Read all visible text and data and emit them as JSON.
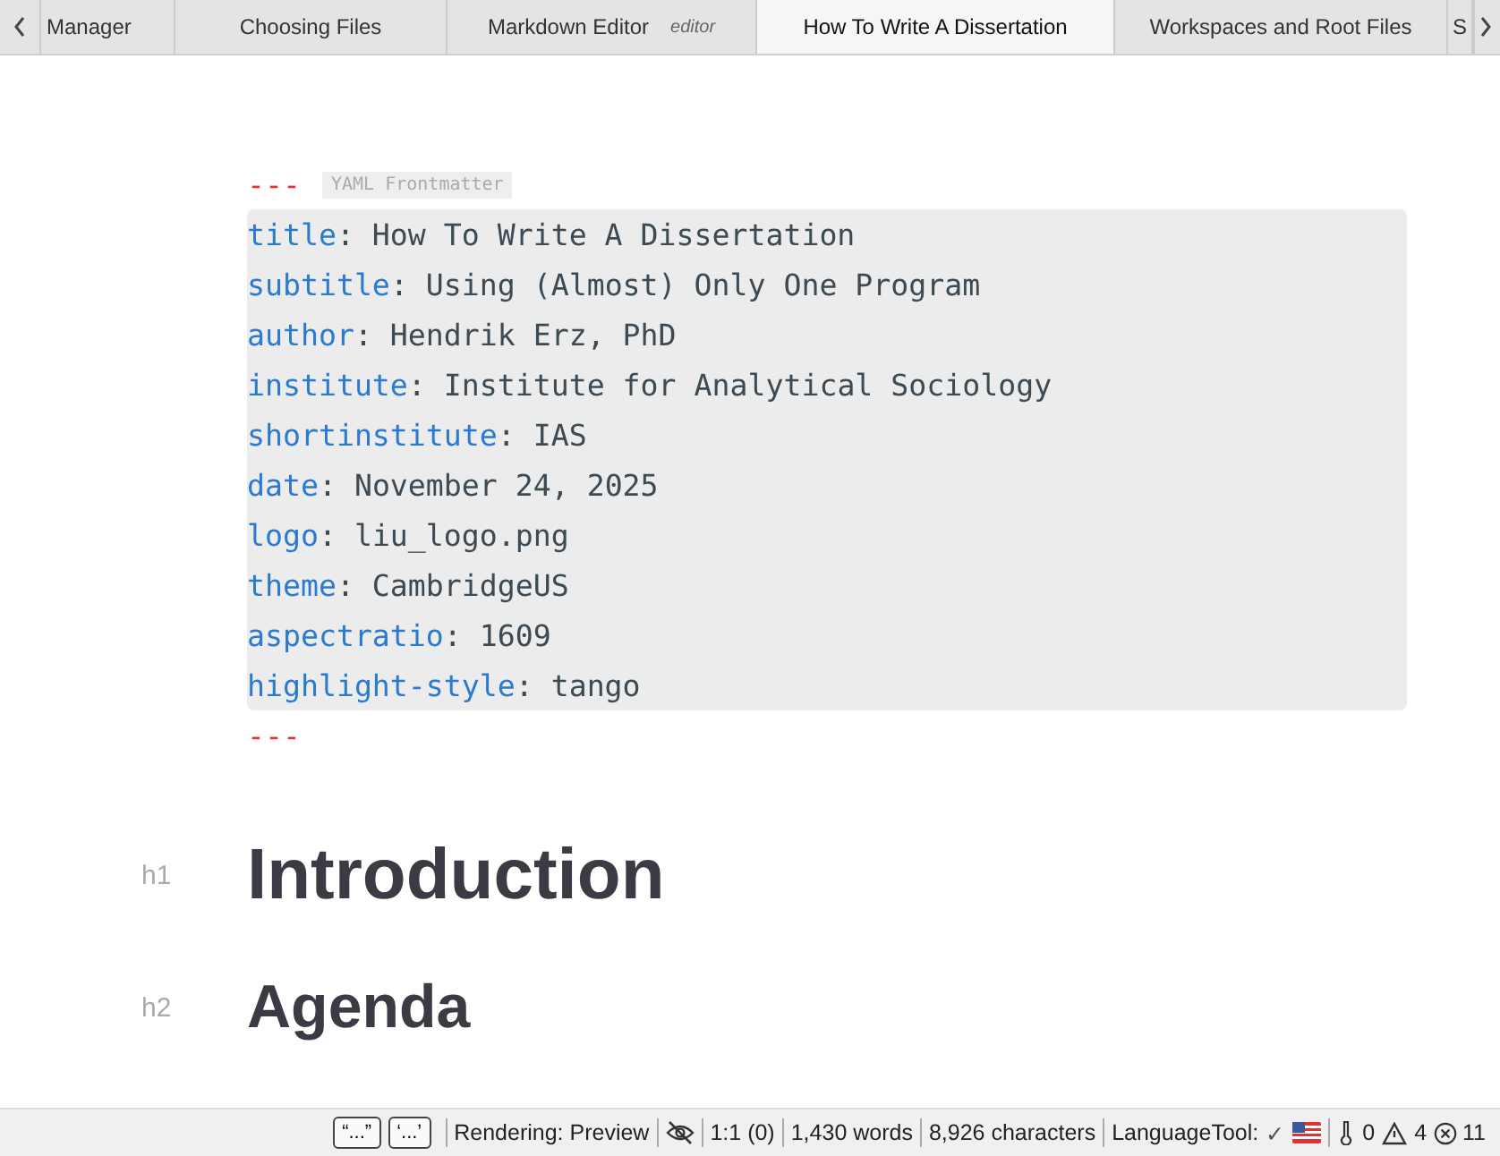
{
  "tabs": [
    {
      "label": "Manager",
      "selected": false
    },
    {
      "label": "Choosing Files",
      "selected": false
    },
    {
      "label": "Markdown Editor",
      "note": "editor",
      "selected": false
    },
    {
      "label": "How To Write A Dissertation",
      "selected": true
    },
    {
      "label": "Workspaces and Root Files",
      "selected": false
    },
    {
      "label": "S",
      "selected": false
    }
  ],
  "frontmatter": {
    "delimiter_open": "---",
    "badge": "YAML Frontmatter",
    "delimiter_close": "---",
    "entries": [
      {
        "key": "title",
        "separator": ":",
        "value": "How To Write A Dissertation"
      },
      {
        "key": "subtitle",
        "separator": ":",
        "value": "Using (Almost) Only One Program"
      },
      {
        "key": "author",
        "separator": ":",
        "value": "Hendrik Erz, PhD"
      },
      {
        "key": "institute",
        "separator": ":",
        "value": "Institute for Analytical Sociology"
      },
      {
        "key": "shortinstitute",
        "separator": ":",
        "value": "IAS"
      },
      {
        "key": "date",
        "separator": ":",
        "value": "November 24, 2025"
      },
      {
        "key": "logo",
        "separator": ":",
        "value": "liu_logo.png"
      },
      {
        "key": "theme",
        "separator": ":",
        "value": "CambridgeUS"
      },
      {
        "key": "aspectratio",
        "separator": ":",
        "value": "1609"
      },
      {
        "key": "highlight-style",
        "separator": ":",
        "value": "tango"
      }
    ]
  },
  "headings": [
    {
      "level": "h1",
      "text": "Introduction"
    },
    {
      "level": "h2",
      "text": "Agenda"
    }
  ],
  "status_bar": {
    "quote_buttons": [
      "“...”",
      "‘...’"
    ],
    "rendering": "Rendering: Preview",
    "cursor": "1:1 (0)",
    "words": "1,430 words",
    "characters": "8,926 characters",
    "language_tool": "LanguageTool:",
    "language_tool_check": "✓",
    "info_count": "0",
    "warning_count": "4",
    "error_count": "11"
  }
}
